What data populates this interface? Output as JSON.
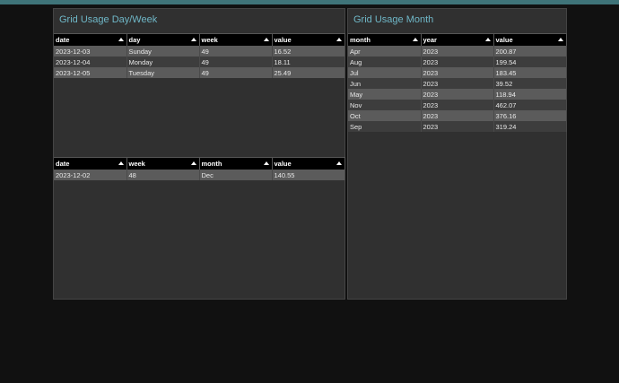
{
  "left_panel": {
    "title": "Grid Usage Day/Week",
    "day_table": {
      "headers": [
        "date",
        "day",
        "week",
        "value"
      ],
      "rows": [
        [
          "2023-12-03",
          "Sunday",
          "49",
          "16.52"
        ],
        [
          "2023-12-04",
          "Monday",
          "49",
          "18.11"
        ],
        [
          "2023-12-05",
          "Tuesday",
          "49",
          "25.49"
        ]
      ]
    },
    "week_table": {
      "headers": [
        "date",
        "week",
        "month",
        "value"
      ],
      "rows": [
        [
          "2023-12-02",
          "48",
          "Dec",
          "140.55"
        ]
      ]
    }
  },
  "right_panel": {
    "title": "Grid Usage Month",
    "month_table": {
      "headers": [
        "month",
        "year",
        "value"
      ],
      "rows": [
        [
          "Apr",
          "2023",
          "200.87"
        ],
        [
          "Aug",
          "2023",
          "199.54"
        ],
        [
          "Jul",
          "2023",
          "183.45"
        ],
        [
          "Jun",
          "2023",
          "39.52"
        ],
        [
          "May",
          "2023",
          "118.94"
        ],
        [
          "Nov",
          "2023",
          "462.07"
        ],
        [
          "Oct",
          "2023",
          "376.16"
        ],
        [
          "Sep",
          "2023",
          "319.24"
        ]
      ]
    }
  },
  "colors": {
    "topbar": "#3f7479",
    "title": "#6fb7c7",
    "background": "#111111",
    "panel": "#303030"
  },
  "icons": {
    "sort": "sort-asc-icon"
  }
}
